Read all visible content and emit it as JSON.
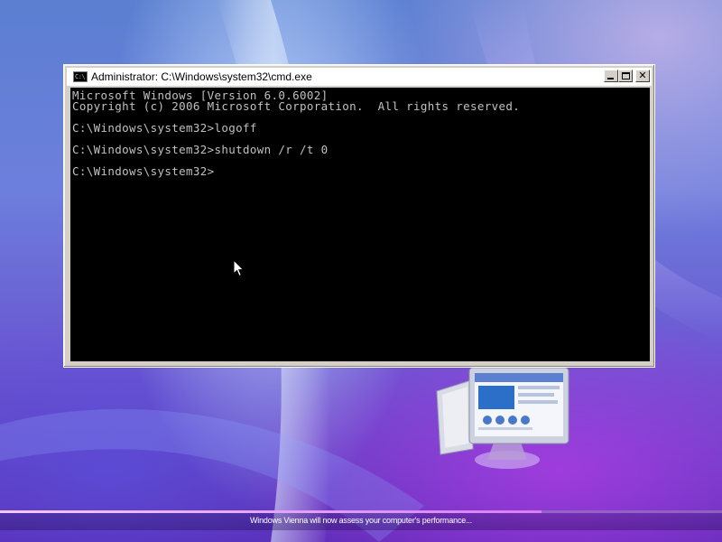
{
  "window": {
    "title": "Administrator: C:\\Windows\\system32\\cmd.exe",
    "app_icon_text": "C:\\",
    "minimize_label": "",
    "maximize_label": "",
    "close_label": "✕",
    "icon": "cmd-icon"
  },
  "terminal": {
    "lines": [
      "Microsoft Windows [Version 6.0.6002]",
      "Copyright (c) 2006 Microsoft Corporation.  All rights reserved.",
      "",
      "C:\\Windows\\system32>logoff",
      "",
      "C:\\Windows\\system32>shutdown /r /t 0",
      "",
      "C:\\Windows\\system32>"
    ],
    "text_color": "#c0c0c0",
    "background": "#000000"
  },
  "status": {
    "message": "Windows Vienna will now assess your computer's performance...",
    "progress": 0.75
  },
  "colors": {
    "accent": "#d77ef5"
  }
}
